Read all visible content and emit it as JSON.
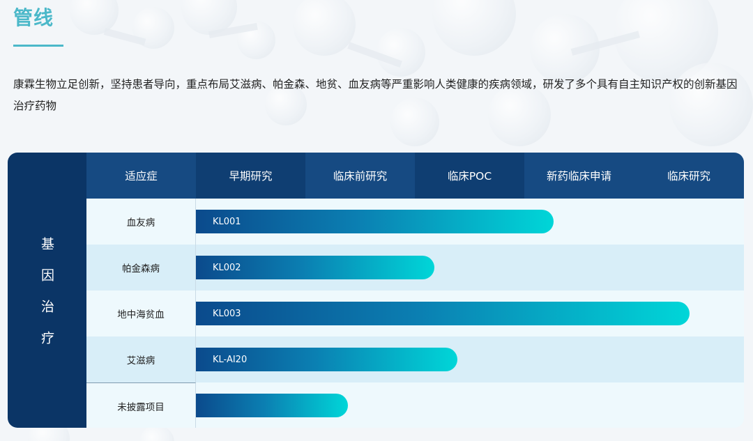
{
  "page": {
    "title": "管线",
    "intro": "康霖生物立足创新，坚持患者导向，重点布局艾滋病、帕金森、地贫、血友病等严重影响人类健康的疾病领域，研发了多个具有自主知识产权的创新基因治疗药物"
  },
  "pipeline": {
    "category": "基因治疗",
    "headers": [
      "适应症",
      "早期研究",
      "临床前研究",
      "临床POC",
      "新药临床申请",
      "临床研究"
    ],
    "rows": [
      {
        "indication": "血友病",
        "program": "KL001",
        "progress": 0.653
      },
      {
        "indication": "帕金森病",
        "program": "KL002",
        "progress": 0.435
      },
      {
        "indication": "地中海贫血",
        "program": "KL003",
        "progress": 0.901
      },
      {
        "indication": "艾滋病",
        "program": "KL-AI20",
        "progress": 0.477
      },
      {
        "indication": "未披露项目",
        "program": "",
        "progress": 0.277
      }
    ]
  },
  "colors": {
    "accent": "#4bb8c9",
    "header_dark": "#0b3566",
    "bar_start": "#0b4a8c",
    "bar_end": "#00d6d8"
  }
}
